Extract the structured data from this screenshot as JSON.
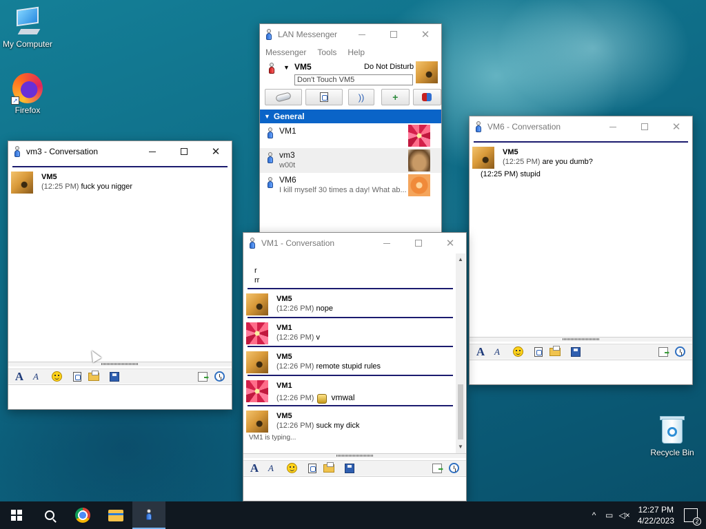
{
  "desktop": {
    "icons": [
      {
        "label": "My Computer"
      },
      {
        "label": "Firefox"
      },
      {
        "label": "Recycle Bin"
      }
    ]
  },
  "main_window": {
    "title": "LAN Messenger",
    "menu": [
      "Messenger",
      "Tools",
      "Help"
    ],
    "user_name": "VM5",
    "status": "Do Not Disturb",
    "note": "Don't Touch VM5",
    "group": "General",
    "contacts": [
      {
        "name": "VM1",
        "status": "",
        "avatar": "star"
      },
      {
        "name": "vm3",
        "status": "w00t",
        "avatar": "cat"
      },
      {
        "name": "VM6",
        "status": "I kill myself 30 times a day! What ab...",
        "avatar": "orange"
      }
    ]
  },
  "vm3_window": {
    "title": "vm3 - Conversation",
    "messages": [
      {
        "sender": "VM5",
        "time": "(12:25 PM)",
        "text": "fuck you nigger"
      }
    ]
  },
  "vm6_window": {
    "title": "VM6 - Conversation",
    "messages": [
      {
        "sender": "VM5",
        "time": "(12:25 PM)",
        "text": "are you dumb?"
      },
      {
        "sender": "",
        "time": "(12:25 PM)",
        "text": "stupid"
      }
    ]
  },
  "vm1_window": {
    "title": "VM1 - Conversation",
    "pre_lines": [
      "r",
      "rr"
    ],
    "messages": [
      {
        "sender": "VM5",
        "time": "(12:26 PM)",
        "text": "nope"
      },
      {
        "sender": "VM1",
        "time": "(12:26 PM)",
        "text": "v"
      },
      {
        "sender": "VM5",
        "time": "(12:26 PM)",
        "text": "remote stupid rules"
      },
      {
        "sender": "VM1",
        "time": "(12:26 PM)",
        "text": "vmwal"
      },
      {
        "sender": "VM5",
        "time": "(12:26 PM)",
        "text": "suck my dick"
      }
    ],
    "typing": "VM1 is typing..."
  },
  "taskbar": {
    "time": "12:27 PM",
    "date": "4/22/2023",
    "notifications": "2"
  },
  "colors": {
    "accent": "#0a64c8",
    "separator": "#1a1a6e"
  }
}
